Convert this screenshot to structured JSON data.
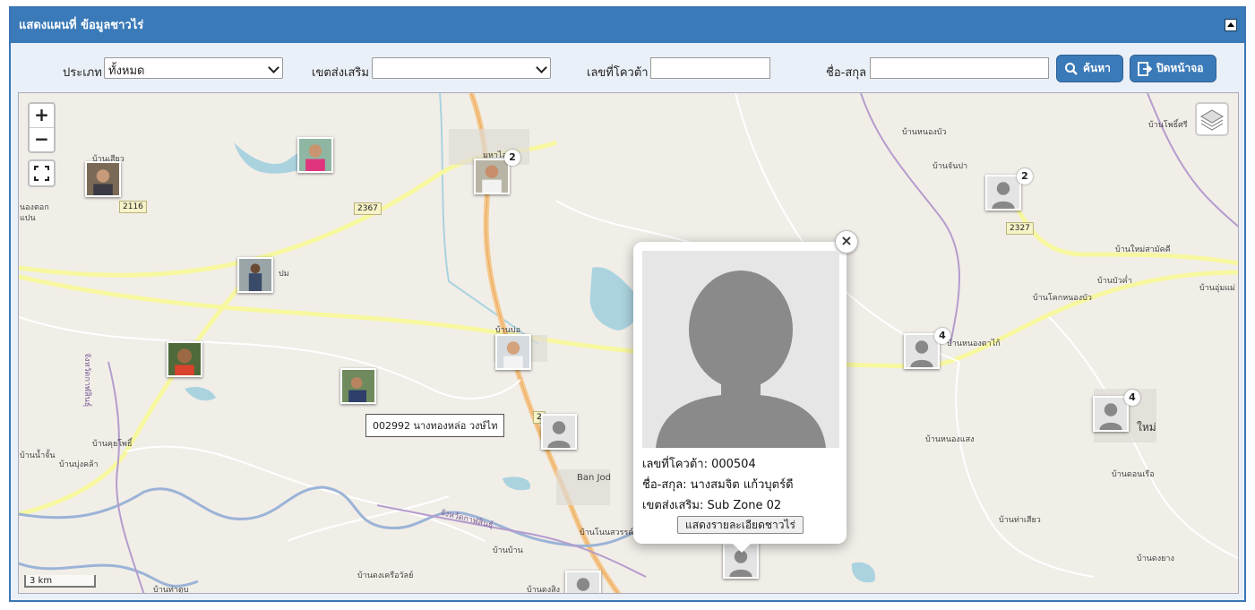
{
  "header": {
    "title": "แสดงแผนที่ ข้อมูลชาวไร่"
  },
  "filters": {
    "type_label": "ประเภท",
    "type_value": "ทั้งหมด",
    "zone_label": "เขตส่งเสริม",
    "zone_value": "",
    "quota_label": "เลขที่โควต้า",
    "quota_value": "",
    "name_label": "ชื่อ-สกุล",
    "name_value": "",
    "search_button": "ค้นหา",
    "close_button": "ปิดหน้าจอ"
  },
  "map": {
    "zoom_in": "+",
    "zoom_out": "−",
    "scale_label": "3 km",
    "roads": [
      "2116",
      "2367",
      "2327",
      "2"
    ],
    "places": [
      "บ้านเสียว",
      "นองตอก",
      "แปน",
      "มหาไลย",
      "บ้านหนองบัว",
      "บ้านโพธิ์ศรี",
      "บ้านจันปา",
      "บ้านใหม่สามัคคี",
      "บ้านบัวค่ำ",
      "บ้านอุ่มแม่",
      "บ้านโคกหนองบัว",
      "บ้านหนองตาไก้",
      "บ้านบ่อ",
      "ปม",
      "บ้านคุยโพธิ์",
      "บ้านบุ่งคล้า",
      "บ้านน้ำจั้น",
      "Ban Jod",
      "บ้านโนนสวรรค์",
      "บ้านบ้าน",
      "บ้านดงเครือวัลย์",
      "บ้านท่าตูบ",
      "บ้านดงสิง",
      "บ้านหนองแสง",
      "บ้านดอนเรือ",
      "บ้านท่าเสียว",
      "บ้านดงยาง",
      "ใหม่"
    ],
    "provinces": [
      "จังหวัดกาฬสินธุ์",
      "จังหวัดกาฬสินธุ์"
    ],
    "markers": [
      {
        "photo": "woman-portrait",
        "badge": ""
      },
      {
        "photo": "woman-pink-shirt",
        "badge": ""
      },
      {
        "photo": "woman-white-shirt",
        "badge": "2"
      },
      {
        "photo": "default-avatar",
        "badge": "2"
      },
      {
        "photo": "man-field",
        "badge": ""
      },
      {
        "photo": "boy-portrait",
        "badge": ""
      },
      {
        "photo": "man-glasses",
        "badge": ""
      },
      {
        "photo": "woman-outdoor",
        "badge": ""
      },
      {
        "photo": "default-avatar",
        "badge": ""
      },
      {
        "photo": "default-avatar",
        "badge": "4"
      },
      {
        "photo": "default-avatar",
        "badge": "4"
      },
      {
        "photo": "default-avatar",
        "badge": ""
      },
      {
        "photo": "default-avatar",
        "badge": ""
      }
    ],
    "tooltip": "002992  นางทองหล่อ  วงษ์ไท",
    "popup": {
      "quota_line": "เลขที่โควต้า: 000504",
      "name_line": "ชื่อ-สกุล: นางสมจิต แก้วบุตร์ดี",
      "zone_line": "เขตส่งเสริม: Sub Zone 02",
      "detail_button": "แสดงรายละเอียดชาวไร่",
      "close": "×"
    }
  }
}
